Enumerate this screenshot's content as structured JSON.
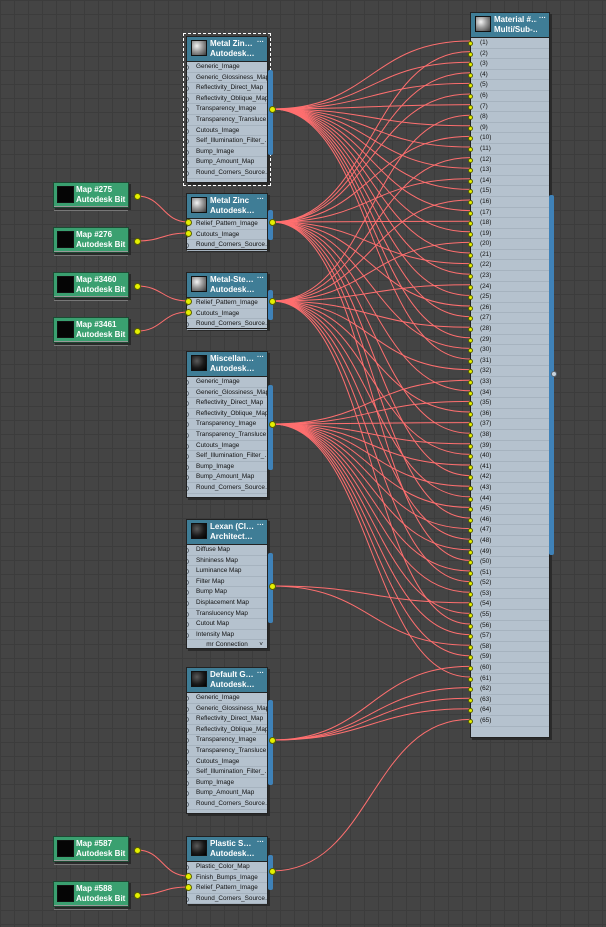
{
  "colors": {
    "wire": "#ff6f6f",
    "header": "#3f7d96",
    "map_node": "#3aa070",
    "socket": "#e5f000",
    "body": "#b5c2ce"
  },
  "nodes": {
    "metal_zinc_1": {
      "title1": "Metal Zin…",
      "title2": "Autodesk…",
      "dots": "···",
      "rows": [
        "Generic_Image",
        "Generic_Glossiness_Map",
        "Reflectivity_Direct_Map",
        "Reflectivity_Oblique_Map",
        "Transparency_Image",
        "Transparency_Transluce…",
        "Cutouts_Image",
        "Self_Illumination_Filter_…",
        "Bump_Image",
        "Bump_Amount_Map",
        "Round_Corners_Source…"
      ]
    },
    "metal_zinc_2": {
      "title1": "Metal Zinc",
      "title2": "Autodesk…",
      "dots": "···",
      "rows": [
        "Relief_Pattern_Image",
        "Cutouts_Image",
        "Round_Corners_Source…"
      ]
    },
    "metal_steel": {
      "title1": "Metal-Ste…",
      "title2": "Autodesk…",
      "dots": "···",
      "rows": [
        "Relief_Pattern_Image",
        "Cutouts_Image",
        "Round_Corners_Source…"
      ]
    },
    "miscellan": {
      "title1": "Miscellan…",
      "title2": "Autodesk…",
      "dots": "···",
      "rows": [
        "Generic_Image",
        "Generic_Glossiness_Map",
        "Reflectivity_Direct_Map",
        "Reflectivity_Oblique_Map",
        "Transparency_Image",
        "Transparency_Transluce…",
        "Cutouts_Image",
        "Self_Illumination_Filter_…",
        "Bump_Image",
        "Bump_Amount_Map",
        "Round_Corners_Source…"
      ]
    },
    "lexan": {
      "title1": "Lexan (Cl…",
      "title2": "Architect…",
      "dots": "···",
      "rows": [
        "Diffuse Map",
        "Shininess Map",
        "Luminance Map",
        "Filter Map",
        "Bump Map",
        "Displacement Map",
        "Translucency Map",
        "Cutout Map",
        "Intensity Map"
      ],
      "footer": "mr Connection",
      "footer_arrow": "˅"
    },
    "default_g": {
      "title1": "Default G…",
      "title2": "Autodesk…",
      "dots": "···",
      "rows": [
        "Generic_Image",
        "Generic_Glossiness_Map",
        "Reflectivity_Direct_Map",
        "Reflectivity_Oblique_Map",
        "Transparency_Image",
        "Transparency_Transluce…",
        "Cutouts_Image",
        "Self_Illumination_Filter_…",
        "Bump_Image",
        "Bump_Amount_Map",
        "Round_Corners_Source…"
      ]
    },
    "plastic": {
      "title1": "Plastic S…",
      "title2": "Autodesk…",
      "dots": "···",
      "rows": [
        "Plastic_Color_Map",
        "Finish_Bumps_Image",
        "Relief_Pattern_Image",
        "Round_Corners_Source…"
      ]
    },
    "material": {
      "title1": "Material #…",
      "title2": "Multi/Sub-…",
      "dots": "···"
    }
  },
  "map_nodes": {
    "m275": {
      "title1": "Map #275",
      "title2": "Autodesk Bit…"
    },
    "m276": {
      "title1": "Map #276",
      "title2": "Autodesk Bit…"
    },
    "m3460": {
      "title1": "Map #3460",
      "title2": "Autodesk Bit…"
    },
    "m3461": {
      "title1": "Map #3461",
      "title2": "Autodesk Bit…"
    },
    "m587": {
      "title1": "Map #587",
      "title2": "Autodesk Bit…"
    },
    "m588": {
      "title1": "Map #588",
      "title2": "Autodesk Bit…"
    }
  },
  "material_slots": [
    "(1)",
    "(2)",
    "(3)",
    "(4)",
    "(5)",
    "(6)",
    "(7)",
    "(8)",
    "(9)",
    "(10)",
    "(11)",
    "(12)",
    "(13)",
    "(14)",
    "(15)",
    "(16)",
    "(17)",
    "(18)",
    "(19)",
    "(20)",
    "(21)",
    "(22)",
    "(23)",
    "(24)",
    "(25)",
    "(26)",
    "(27)",
    "(28)",
    "(29)",
    "(30)",
    "(31)",
    "(32)",
    "(33)",
    "(34)",
    "(35)",
    "(36)",
    "(37)",
    "(38)",
    "(39)",
    "(40)",
    "(41)",
    "(42)",
    "(43)",
    "(44)",
    "(45)",
    "(46)",
    "(47)",
    "(48)",
    "(49)",
    "(50)",
    "(51)",
    "(52)",
    "(53)",
    "(54)",
    "(55)",
    "(56)",
    "(57)",
    "(58)",
    "(59)",
    "(60)",
    "(61)",
    "(62)",
    "(63)",
    "(64)",
    "(65)"
  ]
}
